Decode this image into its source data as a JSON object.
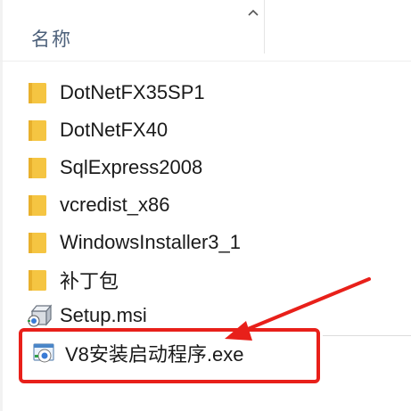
{
  "header": {
    "column_name_label": "名称",
    "sort_icon": "chevron-up-icon"
  },
  "files": [
    {
      "name": "DotNetFX35SP1",
      "type": "folder",
      "icon": "folder-icon"
    },
    {
      "name": "DotNetFX40",
      "type": "folder",
      "icon": "folder-icon"
    },
    {
      "name": "SqlExpress2008",
      "type": "folder",
      "icon": "folder-icon"
    },
    {
      "name": "vcredist_x86",
      "type": "folder",
      "icon": "folder-icon"
    },
    {
      "name": "WindowsInstaller3_1",
      "type": "folder",
      "icon": "folder-icon"
    },
    {
      "name": "补丁包",
      "type": "folder",
      "icon": "folder-icon"
    },
    {
      "name": "Setup.msi",
      "type": "msi",
      "icon": "msi-package-icon"
    },
    {
      "name": "V8安装启动程序.exe",
      "type": "exe",
      "icon": "installer-exe-icon",
      "highlighted": true
    }
  ],
  "annotation": {
    "highlight_color": "#e8201a",
    "arrow_color": "#e8201a"
  },
  "colors": {
    "folder": "#f5c542",
    "header_text": "#4c607a"
  }
}
